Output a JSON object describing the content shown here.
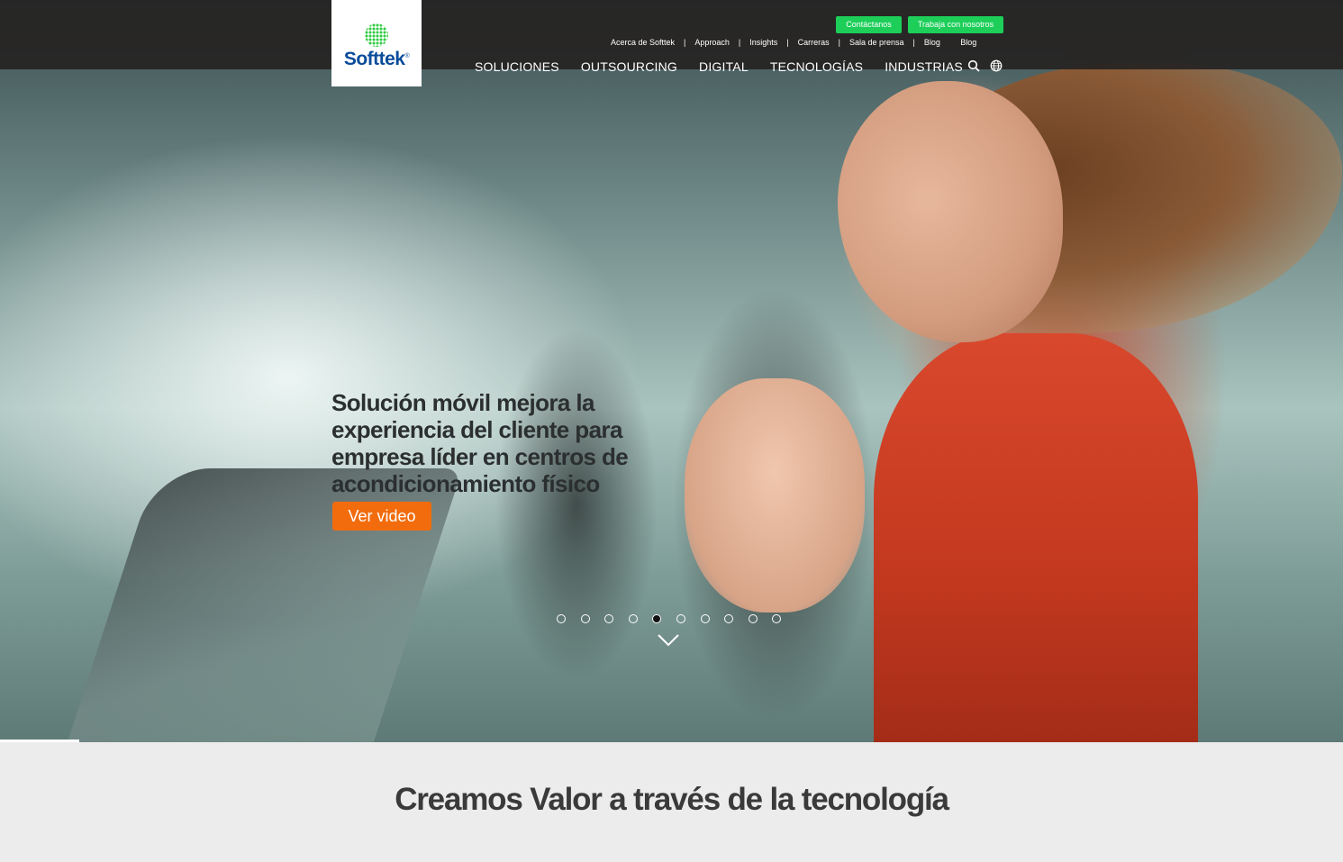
{
  "brand": {
    "name": "Softtek",
    "reg": "®",
    "primary_color": "#0a4c9a",
    "accent_green": "#1dce59",
    "cta_orange": "#f26c0d"
  },
  "header": {
    "cta_contact": "Contáctanos",
    "cta_work": "Trabaja con nosotros",
    "util_links": [
      "Acerca de Softtek",
      "Approach",
      "Insights",
      "Carreras",
      "Sala de prensa",
      "Blog",
      "Blog"
    ],
    "main_nav": [
      "SOLUCIONES",
      "OUTSOURCING",
      "DIGITAL",
      "TECNOLOGÍAS",
      "INDUSTRIAS"
    ],
    "icons": [
      "search-icon",
      "globe-icon"
    ]
  },
  "hero": {
    "title": "Solución móvil mejora la experiencia del cliente para empresa líder en centros de acondicionamiento físico",
    "button": "Ver video",
    "slides_total": 10,
    "active_slide": 5
  },
  "tagline": "Creamos Valor a través de la tecnología"
}
